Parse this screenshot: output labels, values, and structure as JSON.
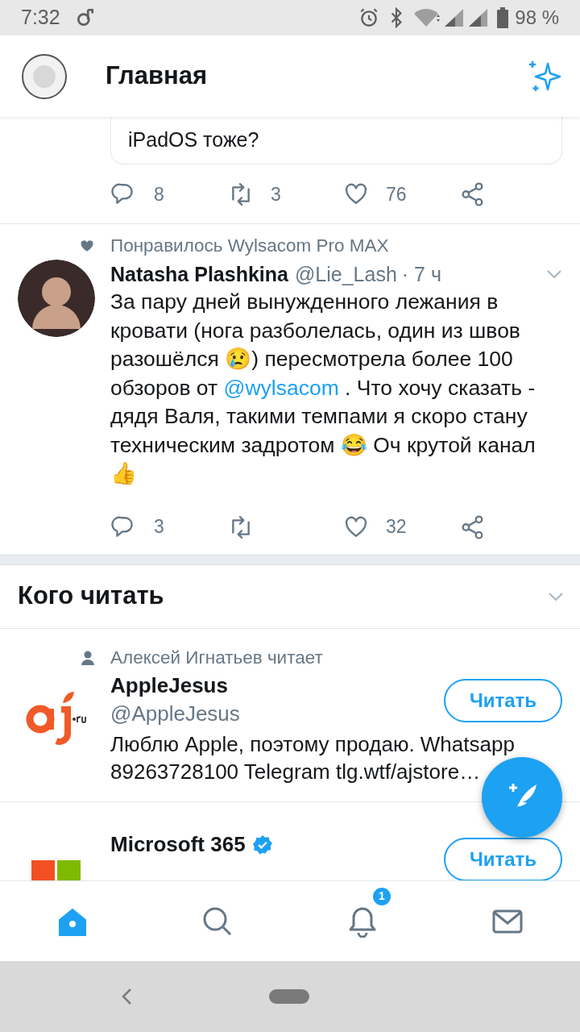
{
  "status_bar": {
    "time": "7:32",
    "battery": "98 %"
  },
  "header": {
    "title": "Главная"
  },
  "feed": [
    {
      "kind": "partial",
      "quote_text": "iPadOS тоже?",
      "stats": {
        "replies": "8",
        "retweets": "3",
        "likes": "76"
      }
    },
    {
      "kind": "full",
      "context": "Понравилось Wylsacom Pro MAX",
      "name": "Natasha Plashkina",
      "handle": "@Lie_Lash",
      "time": "· 7 ч",
      "text_parts": [
        {
          "kind": "text",
          "text": "За пару дней вынужденного лежания в кровати (нога разболелась, один из швов разошёлся 😢) пересмотрела более 100 обзоров от "
        },
        {
          "kind": "mention",
          "text": "@wylsacom"
        },
        {
          "kind": "text",
          "text": " . Что хочу сказать - дядя Валя, такими темпами я скоро стану техническим задротом 😂 Оч крутой канал 👍"
        }
      ],
      "stats": {
        "replies": "3",
        "likes": "32"
      }
    }
  ],
  "who_to_follow": {
    "title": "Кого читать",
    "users": [
      {
        "kind": "aj",
        "context": "Алексей Игнатьев читает",
        "name": " AppleJesus",
        "verified": false,
        "handle": "@AppleJesus",
        "bio": "Люблю Apple, поэтому продаю. Whatsapp 89263728100 Telegram tlg.wtf/ajstore…",
        "button": "Читать"
      },
      {
        "kind": "ms",
        "name": "Microsoft 365",
        "verified": true,
        "button": "Читать"
      }
    ]
  },
  "bottom_nav": [
    {
      "kind": "home",
      "selected": true
    },
    {
      "kind": "search",
      "selected": false
    },
    {
      "kind": "bell",
      "selected": false,
      "badge": "1"
    },
    {
      "kind": "mail",
      "selected": false
    }
  ]
}
